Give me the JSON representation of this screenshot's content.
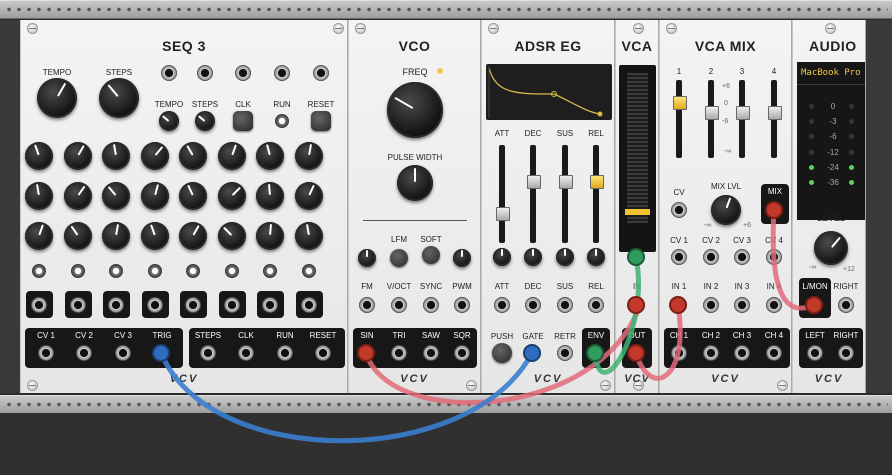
{
  "modules": {
    "seq3": {
      "title": "SEQ 3",
      "tempo": "TEMPO",
      "steps": "STEPS",
      "tempo_in": "TEMPO",
      "steps_in": "STEPS",
      "clk": "CLK",
      "run": "RUN",
      "reset": "RESET",
      "outputs": [
        "CV 1",
        "CV 2",
        "CV 3",
        "TRIG"
      ],
      "gates": [
        "STEPS",
        "CLK",
        "RUN",
        "RESET"
      ]
    },
    "vco": {
      "title": "VCO",
      "freq": "FREQ",
      "pulse_width": "PULSE WIDTH",
      "lfm": "LFM",
      "soft": "SOFT",
      "inputs": [
        "FM",
        "V/OCT",
        "SYNC",
        "PWM"
      ],
      "outputs": [
        "SIN",
        "TRI",
        "SAW",
        "SQR"
      ]
    },
    "adsr": {
      "title": "ADSR EG",
      "sliders": [
        "ATT",
        "DEC",
        "SUS",
        "REL"
      ],
      "knobs": [
        "ATT",
        "DEC",
        "SUS",
        "REL"
      ],
      "push": "PUSH",
      "gate": "GATE",
      "retr": "RETR",
      "env": "ENV"
    },
    "vca": {
      "title": "VCA",
      "in": "IN",
      "out": "OUT"
    },
    "vcamix": {
      "title": "VCA MIX",
      "channels": [
        "1",
        "2",
        "3",
        "4"
      ],
      "scale_top": "+6",
      "scale_mid": "0",
      "scale_low": "-6",
      "scale_min": "-∞",
      "cv": "CV",
      "mix_lvl": "MIX LVL",
      "mix_min": "-∞",
      "mix_max": "+6",
      "mix": "MIX",
      "cv_inputs": [
        "CV 1",
        "CV 2",
        "CV 3",
        "CV 4"
      ],
      "inputs": [
        "IN 1",
        "IN 2",
        "IN 3",
        "IN 4"
      ],
      "outputs": [
        "CH 1",
        "CH 2",
        "CH 3",
        "CH 4"
      ]
    },
    "audio": {
      "title": "AUDIO",
      "device": "MacBook Pro",
      "meter": [
        "0",
        "-3",
        "-6",
        "-12",
        "-24",
        "-36"
      ],
      "level": "LEVEL",
      "level_min": "-∞",
      "level_max": "+12",
      "lmon": "L/MON",
      "right": "RIGHT",
      "left_out": "LEFT",
      "right_out": "RIGHT"
    }
  },
  "brand": "VCV",
  "colors": {
    "cable_red": "#e06a78",
    "cable_blue": "#3a7fcf",
    "cable_green": "#3fb274",
    "adsr_curve": "#d8b84a"
  }
}
